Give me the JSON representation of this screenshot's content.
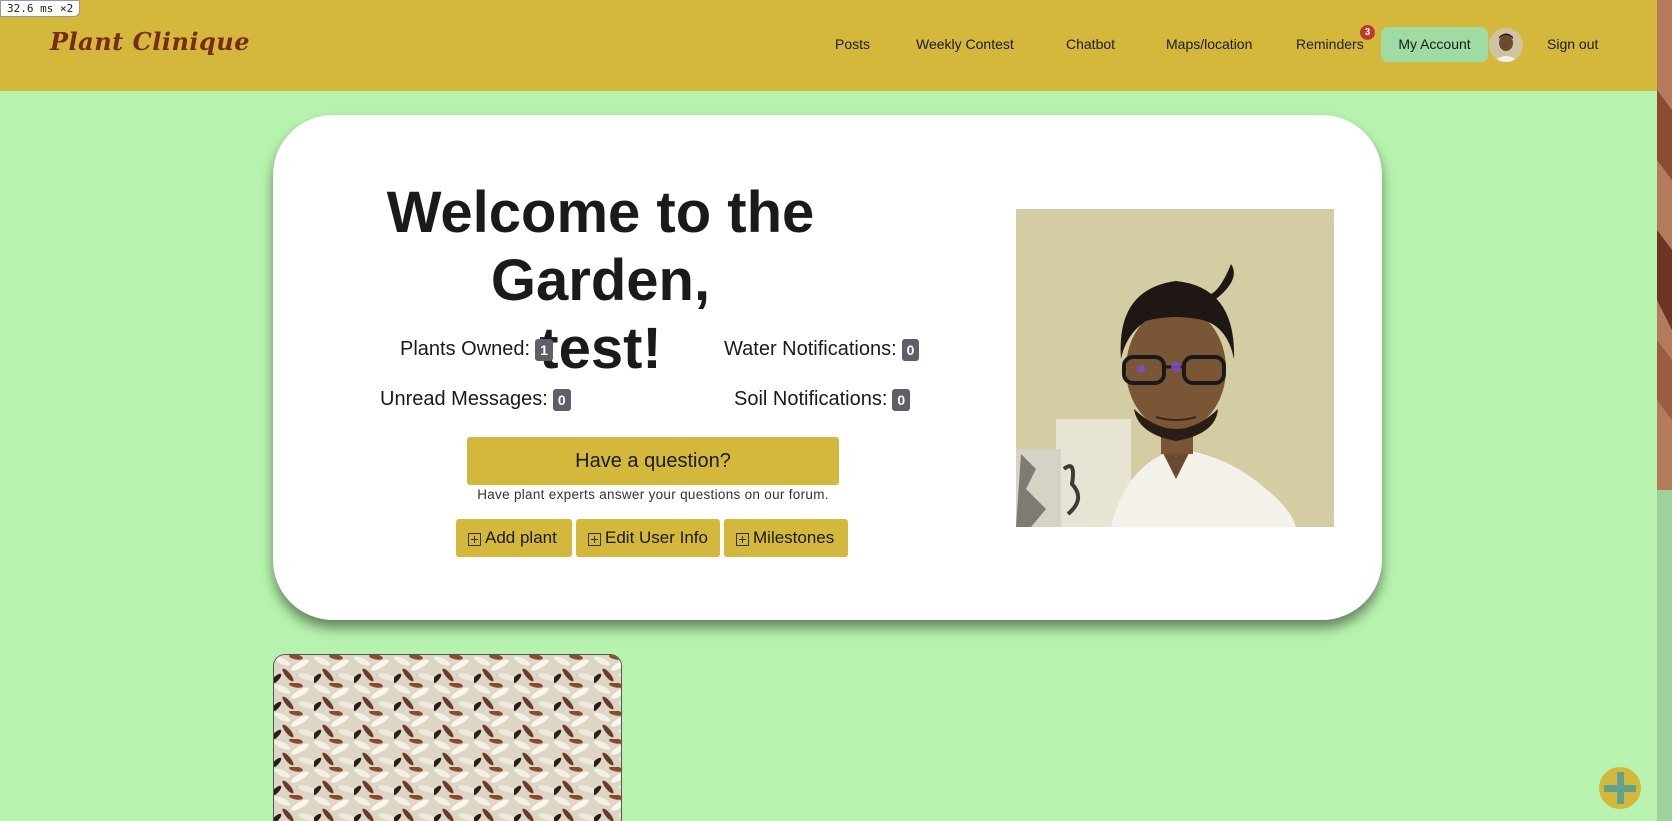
{
  "perf": {
    "label": "32.6 ms ×2"
  },
  "nav": {
    "brand": "Plant Clinique",
    "links": [
      "Posts",
      "Weekly Contest",
      "Chatbot",
      "Maps/location"
    ],
    "reminders_label": "Reminders",
    "reminders_count": "3",
    "account_label": "My Account",
    "signout_label": "Sign out"
  },
  "welcome": {
    "line1": "Welcome to the Garden,",
    "line2": "test!"
  },
  "stats": {
    "plants_owned_label": "Plants Owned:",
    "plants_owned": "1",
    "water_label": "Water Notifications:",
    "water": "0",
    "unread_label": "Unread Messages:",
    "unread": "0",
    "soil_label": "Soil Notifications:",
    "soil": "0"
  },
  "question": {
    "button_label": "Have a question?",
    "note": "Have plant experts answer your questions on our forum."
  },
  "actions": {
    "add_plant": "Add plant",
    "edit_user": "Edit User Info",
    "milestones": "Milestones"
  },
  "colors": {
    "navbar": "#d4b83c",
    "background": "#b7f3ae",
    "account_button": "#9fdca3",
    "badge": "#5d6068",
    "notification": "#c0392b"
  }
}
